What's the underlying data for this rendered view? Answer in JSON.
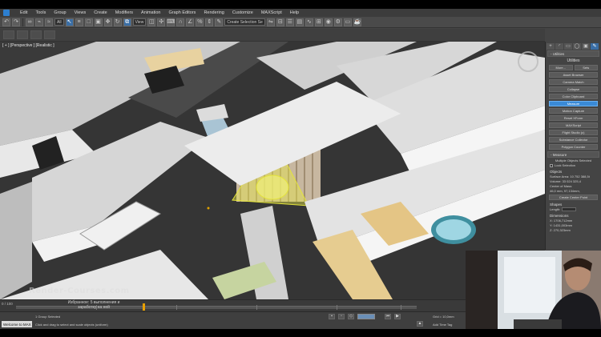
{
  "menubar": {
    "items": [
      "Edit",
      "Tools",
      "Group",
      "Views",
      "Create",
      "Modifiers",
      "Animation",
      "Graph Editors",
      "Rendering",
      "Customize",
      "MAXScript",
      "Help"
    ]
  },
  "toolbar": {
    "selection_filter": "All",
    "reference_coord": "View",
    "named_selection": "Create Selection Se"
  },
  "viewport": {
    "label": "[ + ] [Perspective ] [Realistic ]"
  },
  "watermark": "Render-Courses.com",
  "command_panel": {
    "tabs": [
      "+",
      "◜",
      "▭",
      "◯",
      "▣",
      "✎"
    ],
    "utilities_rollout": "- Utilities",
    "utilities_title": "Utilities",
    "more_label": "More...",
    "sets_label": "Sets",
    "utility_buttons": [
      "Asset Browser",
      "Camera Match",
      "Collapse",
      "Color Clipboard",
      "Measure",
      "Motion Capture",
      "Reset XForm",
      "MAXScript",
      "Flight Studio (c)",
      "Substance Collector",
      "Polygon Counter"
    ],
    "selected_utility": "Measure",
    "measure_rollout": "- Measure",
    "measure_selected": "Multiple Objects Selected",
    "lock_selection": "Lock Selection",
    "objects_label": "Objects",
    "surface_area": "Surface Area: 10 752 388,5t",
    "volume": "Volume: 33 024 325,4",
    "center_of_mass_label": "Center of Mass:",
    "center_of_mass": "46,0 mm, 97,134mm,",
    "create_center_point": "Create Center Point",
    "shapes_label": "Shapes",
    "length_label": "Length:",
    "dimensions_label": "Dimensions",
    "dim_x": "X: 1706,712mm",
    "dim_y": "Y: 1431,003mm",
    "dim_z": "Z: 270,323mm"
  },
  "timeline": {
    "position": "0 / 100",
    "subtitle_line1": "Избранное: 5 выполнения и",
    "subtitle_line2": "заработку на ней"
  },
  "statusbar": {
    "script_field": "Welcome to MAX",
    "selection_status": "1 Group Selected",
    "prompt": "Click and drag to select and scale objects (uniform)",
    "grid": "Grid = 10,0mm",
    "add_time_tag": "Add Time Tag"
  }
}
